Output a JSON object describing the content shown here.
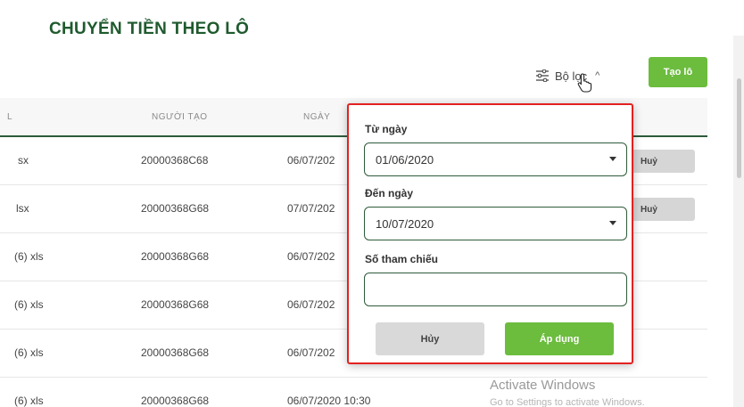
{
  "page": {
    "title": "CHUYỂN TIỀN THEO LÔ"
  },
  "toolbar": {
    "filter_label": "Bộ lọc",
    "filter_icon": "sliders-icon",
    "create_label": "Tạo lô"
  },
  "table": {
    "headers": [
      "L",
      "NGƯỜI TẠO",
      "NGÀY"
    ],
    "rows": [
      {
        "file": "sx",
        "creator": "20000368C68",
        "date": "06/07/202",
        "action": "Huỷ"
      },
      {
        "file": "lsx",
        "creator": "20000368G68",
        "date": "07/07/202",
        "action": "Huỷ"
      },
      {
        "file": "(6) xls",
        "creator": "20000368G68",
        "date": "06/07/202",
        "action": ""
      },
      {
        "file": "(6) xls",
        "creator": "20000368G68",
        "date": "06/07/202",
        "action": ""
      },
      {
        "file": "(6) xls",
        "creator": "20000368G68",
        "date": "06/07/202",
        "action": ""
      },
      {
        "file": "(6) xls",
        "creator": "20000368G68",
        "date": "06/07/2020 10:30",
        "action": ""
      }
    ]
  },
  "filter_panel": {
    "from_label": "Từ ngày",
    "from_value": "01/06/2020",
    "to_label": "Đến ngày",
    "to_value": "10/07/2020",
    "ref_label": "Số tham chiếu",
    "ref_value": "",
    "cancel_label": "Hủy",
    "apply_label": "Áp dụng"
  },
  "watermark": {
    "line1": "Activate Windows",
    "line2": "Go to Settings to activate Windows."
  },
  "colors": {
    "brand_dark": "#1f5a2e",
    "accent_green": "#6cbc3e",
    "highlight_red": "#e32121"
  }
}
